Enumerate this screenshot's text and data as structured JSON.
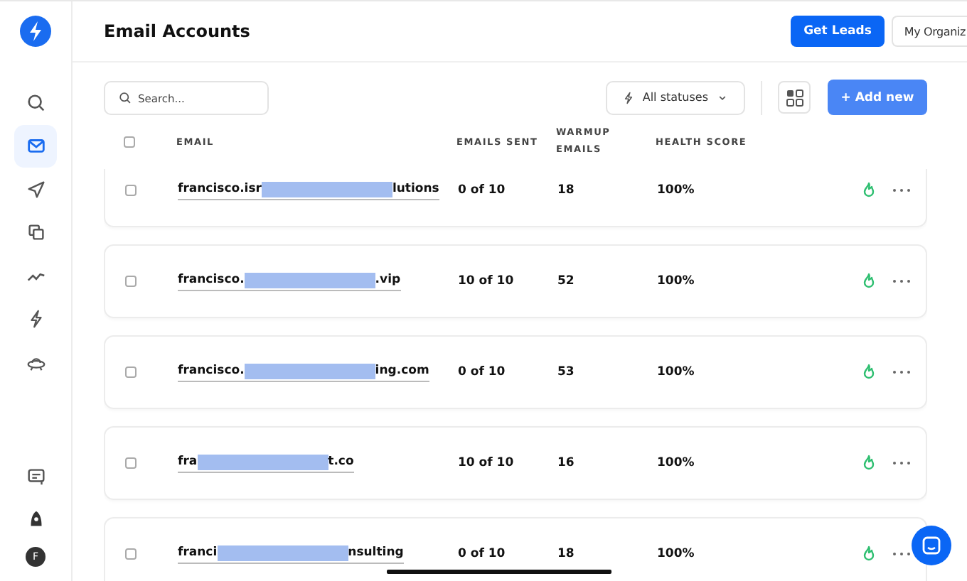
{
  "header": {
    "title": "Email Accounts",
    "buttons": [
      {
        "label": "Get Leads",
        "kind": "primary"
      },
      {
        "label": "My Organiz",
        "kind": "secondary"
      }
    ]
  },
  "sidebar": {
    "items": [
      {
        "selected": false
      },
      {
        "selected": true
      },
      {
        "selected": false
      },
      {
        "selected": false
      },
      {
        "selected": false
      },
      {
        "selected": false
      },
      {
        "selected": false
      }
    ],
    "avatar": "F"
  },
  "toolbar": {
    "search": {
      "placeholder": "Search..."
    },
    "filter": "All statuses",
    "add_button": "+ Add new"
  },
  "table": {
    "all_checked": false,
    "columns": [
      "EMAIL",
      "EMAILS SENT",
      "WARMUP EMAILS",
      "HEALTH SCORE"
    ],
    "rows": [
      {
        "email_start": "francisco.isr",
        "email_end": "lutions",
        "checked": false,
        "sent": "0  of  10",
        "warmup": "18",
        "health": "100%"
      },
      {
        "email_start": "francisco.",
        "email_end": ".vip",
        "checked": false,
        "sent": "10  of  10",
        "warmup": "52",
        "health": "100%"
      },
      {
        "email_start": "francisco.",
        "email_end": "ing.com",
        "checked": false,
        "sent": "0  of  10",
        "warmup": "53",
        "health": "100%"
      },
      {
        "email_start": "fra",
        "email_end": "t.co",
        "checked": false,
        "sent": "10  of  10",
        "warmup": "16",
        "health": "100%"
      },
      {
        "email_start": "franci",
        "email_end": "nsulting",
        "checked": false,
        "sent": "0  of  10",
        "warmup": "18",
        "health": "100%"
      }
    ]
  }
}
